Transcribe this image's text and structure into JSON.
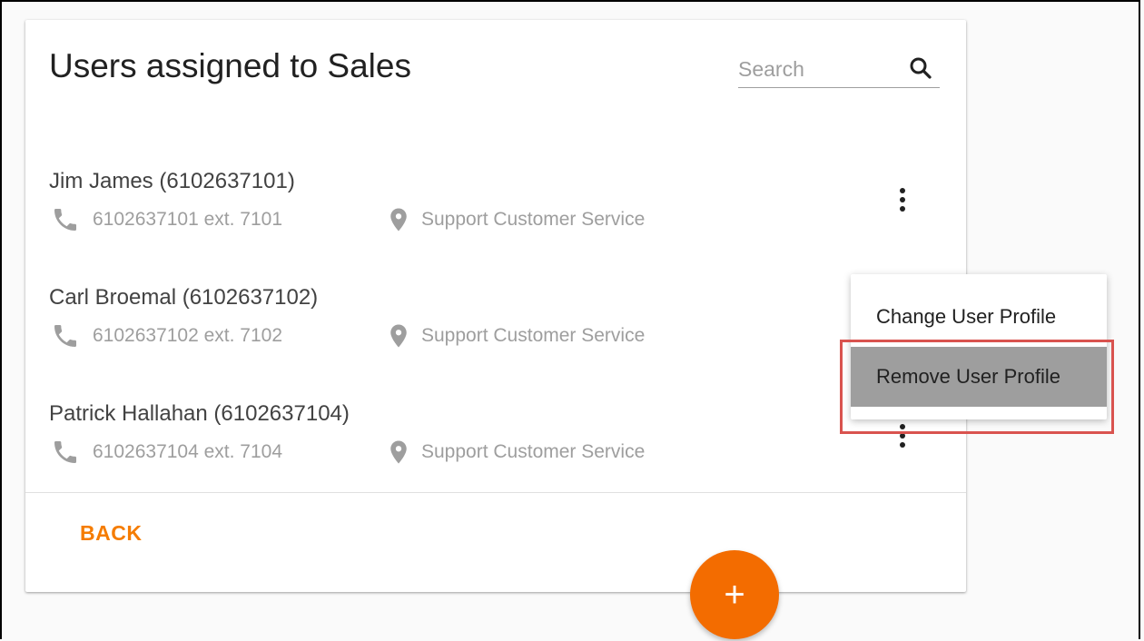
{
  "title": "Users assigned to Sales",
  "search": {
    "placeholder": "Search",
    "value": "",
    "icon": "search-icon"
  },
  "users": [
    {
      "name": "Jim James (6102637101)",
      "phone": "6102637101 ext. 7101",
      "location": "Support Customer Service"
    },
    {
      "name": "Carl Broemal (6102637102)",
      "phone": "6102637102 ext. 7102",
      "location": "Support Customer Service"
    },
    {
      "name": "Patrick Hallahan (6102637104)",
      "phone": "6102637104 ext. 7104",
      "location": "Support Customer Service"
    }
  ],
  "context_menu": {
    "items": [
      {
        "label": "Change User Profile"
      },
      {
        "label": "Remove User Profile",
        "highlighted": true
      }
    ]
  },
  "footer": {
    "back_label": "BACK",
    "add_label": "+"
  },
  "colors": {
    "accent": "#f36c00",
    "back_text": "#f57c00",
    "highlight_border": "#d9534f",
    "menu_hover": "#9e9e9e"
  }
}
